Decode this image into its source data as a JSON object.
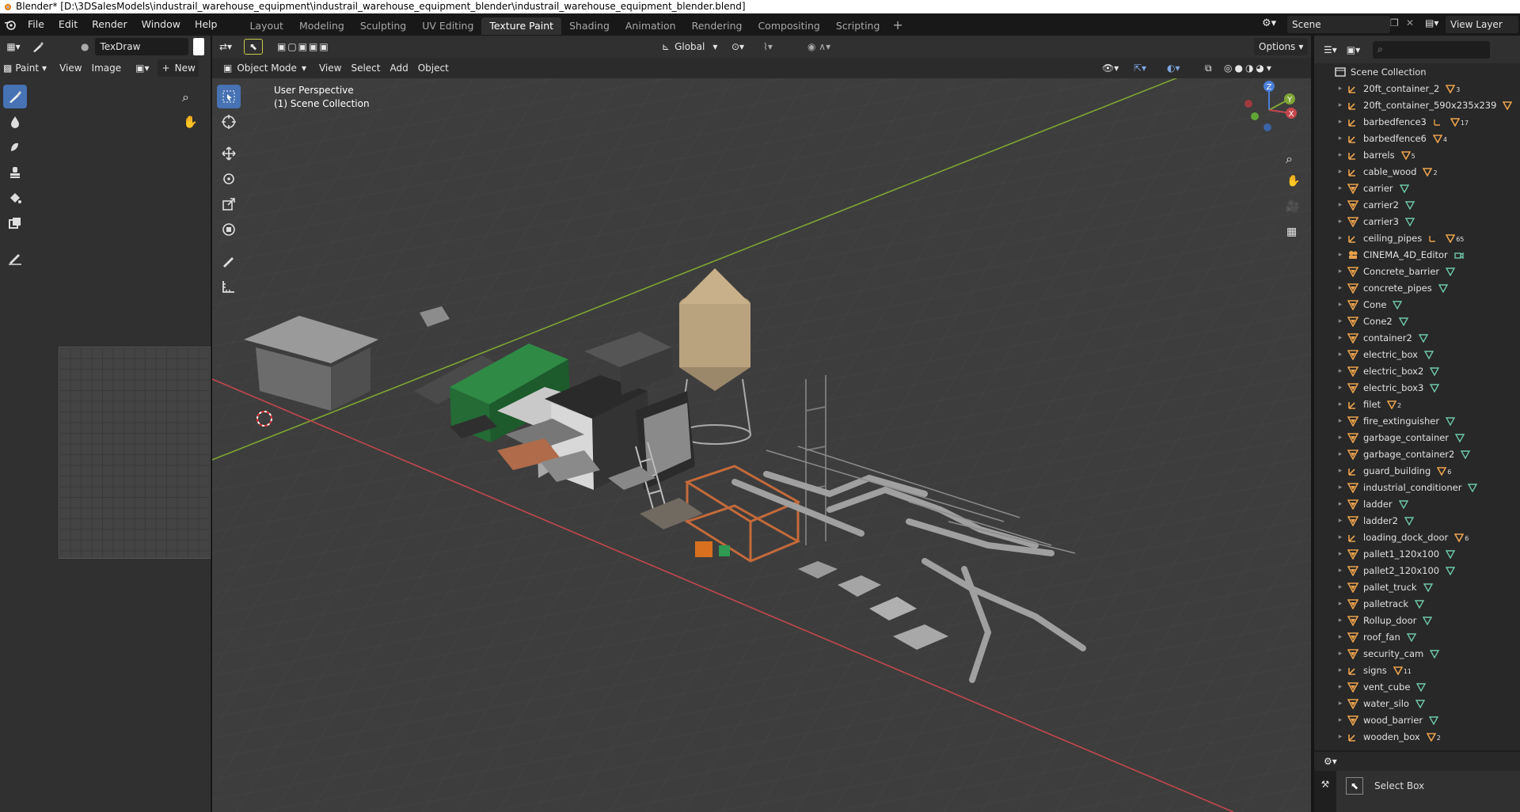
{
  "window": {
    "title": "Blender* [D:\\3DSalesModels\\industrail_warehouse_equipment\\industrail_warehouse_equipment_blender\\industrail_warehouse_equipment_blender.blend]"
  },
  "menu": [
    "File",
    "Edit",
    "Render",
    "Window",
    "Help"
  ],
  "workspaces": [
    "Layout",
    "Modeling",
    "Sculpting",
    "UV Editing",
    "Texture Paint",
    "Shading",
    "Animation",
    "Rendering",
    "Compositing",
    "Scripting"
  ],
  "active_workspace": "Texture Paint",
  "scene": {
    "name": "Scene",
    "view_layer": "View Layer"
  },
  "image_editor": {
    "brush_name": "TexDraw",
    "mode": "Paint",
    "menus": [
      "View",
      "Image"
    ],
    "new_label": "New"
  },
  "viewport_header": {
    "mode": "Object Mode",
    "menus": [
      "View",
      "Select",
      "Add",
      "Object"
    ],
    "orientation": "Global",
    "options_label": "Options"
  },
  "viewport": {
    "perspective": "User Perspective",
    "collection": "(1) Scene Collection"
  },
  "outliner": {
    "root": "Scene Collection",
    "items": [
      {
        "name": "20ft_container_2",
        "type": "empty",
        "badge": "mesh",
        "count": "3"
      },
      {
        "name": "20ft_container_590x235x239",
        "type": "empty",
        "badge": "mesh",
        "count": ""
      },
      {
        "name": "barbedfence3",
        "type": "empty",
        "badge": "empty+mesh",
        "count": "17"
      },
      {
        "name": "barbedfence6",
        "type": "empty",
        "badge": "mesh",
        "count": "4"
      },
      {
        "name": "barrels",
        "type": "empty",
        "badge": "mesh",
        "count": "5"
      },
      {
        "name": "cable_wood",
        "type": "empty",
        "badge": "mesh",
        "count": "2"
      },
      {
        "name": "carrier",
        "type": "mesh",
        "badge": "data",
        "count": ""
      },
      {
        "name": "carrier2",
        "type": "mesh",
        "badge": "data",
        "count": ""
      },
      {
        "name": "carrier3",
        "type": "mesh",
        "badge": "data",
        "count": ""
      },
      {
        "name": "ceiling_pipes",
        "type": "empty",
        "badge": "empty+mesh",
        "count": "65"
      },
      {
        "name": "CINEMA_4D_Editor",
        "type": "camera",
        "badge": "camdata",
        "count": ""
      },
      {
        "name": "Concrete_barrier",
        "type": "mesh",
        "badge": "data",
        "count": ""
      },
      {
        "name": "concrete_pipes",
        "type": "mesh",
        "badge": "data",
        "count": ""
      },
      {
        "name": "Cone",
        "type": "mesh",
        "badge": "data",
        "count": ""
      },
      {
        "name": "Cone2",
        "type": "mesh",
        "badge": "data",
        "count": ""
      },
      {
        "name": "container2",
        "type": "mesh",
        "badge": "data",
        "count": ""
      },
      {
        "name": "electric_box",
        "type": "mesh",
        "badge": "data",
        "count": ""
      },
      {
        "name": "electric_box2",
        "type": "mesh",
        "badge": "data",
        "count": ""
      },
      {
        "name": "electric_box3",
        "type": "mesh",
        "badge": "data",
        "count": ""
      },
      {
        "name": "filet",
        "type": "empty",
        "badge": "mesh",
        "count": "2"
      },
      {
        "name": "fire_extinguisher",
        "type": "mesh",
        "badge": "data",
        "count": ""
      },
      {
        "name": "garbage_container",
        "type": "mesh",
        "badge": "data",
        "count": ""
      },
      {
        "name": "garbage_container2",
        "type": "mesh",
        "badge": "data",
        "count": ""
      },
      {
        "name": "guard_building",
        "type": "empty",
        "badge": "mesh",
        "count": "6"
      },
      {
        "name": "industrial_conditioner",
        "type": "mesh",
        "badge": "data",
        "count": ""
      },
      {
        "name": "ladder",
        "type": "mesh",
        "badge": "data",
        "count": ""
      },
      {
        "name": "ladder2",
        "type": "mesh",
        "badge": "data",
        "count": ""
      },
      {
        "name": "loading_dock_door",
        "type": "empty",
        "badge": "mesh",
        "count": "6"
      },
      {
        "name": "pallet1_120x100",
        "type": "mesh",
        "badge": "data",
        "count": ""
      },
      {
        "name": "pallet2_120x100",
        "type": "mesh",
        "badge": "data",
        "count": ""
      },
      {
        "name": "pallet_truck",
        "type": "mesh",
        "badge": "data",
        "count": ""
      },
      {
        "name": "palletrack",
        "type": "mesh",
        "badge": "data",
        "count": ""
      },
      {
        "name": "Rollup_door",
        "type": "mesh",
        "badge": "data",
        "count": ""
      },
      {
        "name": "roof_fan",
        "type": "mesh",
        "badge": "data",
        "count": ""
      },
      {
        "name": "security_cam",
        "type": "mesh",
        "badge": "data",
        "count": ""
      },
      {
        "name": "signs",
        "type": "empty",
        "badge": "mesh",
        "count": "11"
      },
      {
        "name": "vent_cube",
        "type": "mesh",
        "badge": "data",
        "count": ""
      },
      {
        "name": "water_silo",
        "type": "mesh",
        "badge": "data",
        "count": ""
      },
      {
        "name": "wood_barrier",
        "type": "mesh",
        "badge": "data",
        "count": ""
      },
      {
        "name": "wooden_box",
        "type": "empty",
        "badge": "mesh",
        "count": "2"
      }
    ]
  },
  "properties": {
    "active_tool": "Select Box"
  },
  "colors": {
    "accent": "#4772b3",
    "viewport_bg": "#3d3d3d",
    "grid_line": "#484848",
    "x_axis": "#c4474d",
    "y_axis": "#7ea534",
    "object_orange": "#e8a14c",
    "mesh_data_green": "#6fc8a8"
  }
}
